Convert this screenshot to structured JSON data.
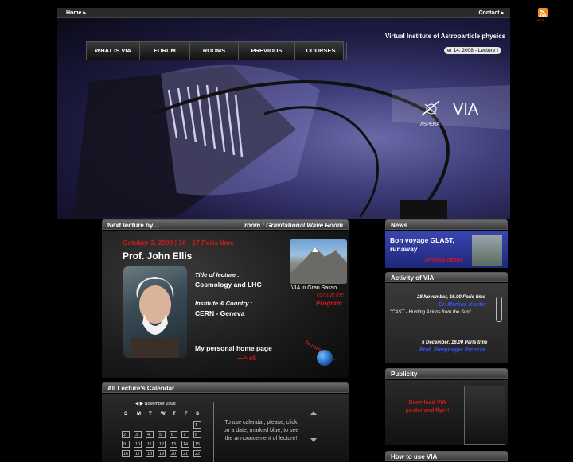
{
  "topbar": {
    "home": "Home ▸",
    "contact": "Contact ▸",
    "rss_label": "RSS"
  },
  "hero": {
    "title": "Virtual Institute of Astroparticle physics",
    "date_pill": "er 14, 2008 - Lecture I",
    "logo": "VIA",
    "aspera": "ASPERA",
    "menu": [
      {
        "label": "WHAT IS VIA",
        "width": 66
      },
      {
        "label": "FORUM",
        "width": 62
      },
      {
        "label": "ROOMS",
        "width": 60
      },
      {
        "label": "PREVIOUS",
        "width": 70
      },
      {
        "label": "COURSES",
        "width": 64
      }
    ]
  },
  "next_lecture": {
    "header": "Next lecture by...",
    "room": "room : Gravitational Wave Room",
    "date": "October 3, 2008 | 16 - 17 Paris time",
    "name": "Prof. John Ellis",
    "title_label": "Title of lecture :",
    "title_value": "Cosmology and LHC",
    "inst_label": "Institute & Country :",
    "inst_value": "CERN - Geneva",
    "home_page": "My personal home page",
    "home_arrow": "—> ok",
    "gran_caption": "VIA in Gran Sasso",
    "consult": "consult the",
    "program": "Program",
    "participate": "To participate..."
  },
  "calendar": {
    "header": "All Lecture's Calendar",
    "month": "◀ ▶  November 2008",
    "days": [
      "S",
      "M",
      "T",
      "W",
      "T",
      "F",
      "S"
    ],
    "rows": [
      [
        "",
        "",
        "",
        "",
        "",
        "",
        "1"
      ],
      [
        "2",
        "3",
        "4",
        "5",
        "6",
        "7",
        "8"
      ],
      [
        "9",
        "10",
        "11",
        "12",
        "13",
        "14",
        "15"
      ],
      [
        "16",
        "17",
        "18",
        "19",
        "20",
        "21",
        "22"
      ]
    ],
    "help": "To use calendar, please, click on a date, marked  blue, to see the announcement of lecture!"
  },
  "news": {
    "header": "News",
    "title": "Bon voyage GLAST, runaway",
    "link": "article&videos"
  },
  "activity": {
    "header": "Activity of VIA",
    "item1_date": "28 November, 16.00 Paris time",
    "item1_name": "Dr. Markus Kuster",
    "item1_title": "\"CAST - Hunting Axions from the Sun\"",
    "item2_date": "5 December, 16.00 Paris time",
    "item2_name": "Prof. Piergiorgio Picozza"
  },
  "publicity": {
    "header": "Publicity",
    "text": "Download VIA poster and flyer!"
  },
  "howto": {
    "header": "How to use VIA"
  }
}
